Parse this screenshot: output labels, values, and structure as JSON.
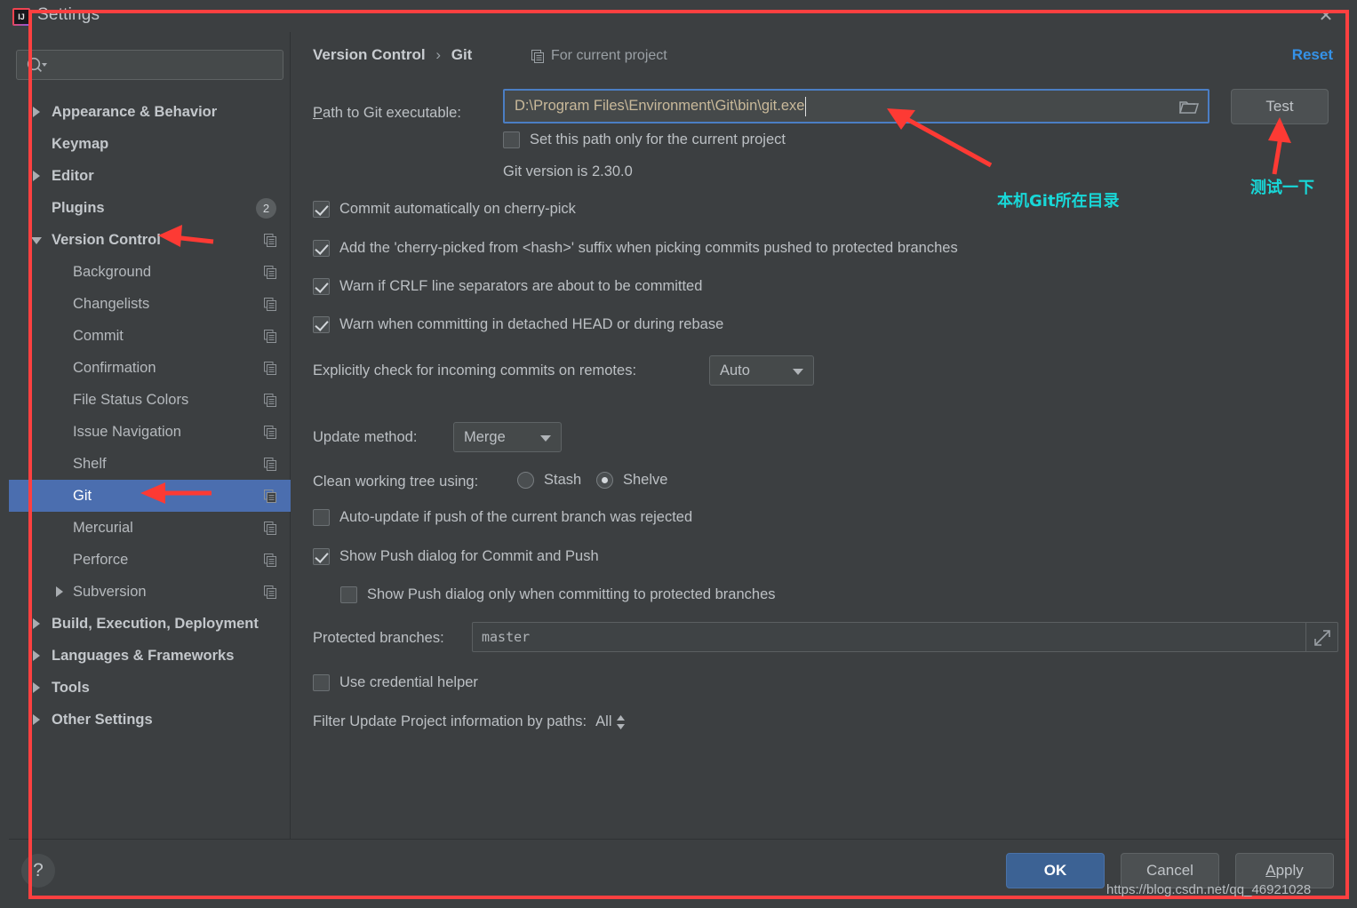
{
  "window": {
    "title": "Settings",
    "logo_icon": "intellij-idea-logo-icon",
    "close_icon": "close-icon"
  },
  "sidebar": {
    "search": {
      "placeholder": "",
      "value": "",
      "icon": "search-icon"
    },
    "items": [
      {
        "label": "Appearance & Behavior",
        "level": 0,
        "bold": true,
        "twisty": "collapsed",
        "copy_icon": false
      },
      {
        "label": "Keymap",
        "level": 0,
        "bold": true,
        "twisty": "none",
        "copy_icon": false
      },
      {
        "label": "Editor",
        "level": 0,
        "bold": true,
        "twisty": "collapsed",
        "copy_icon": false
      },
      {
        "label": "Plugins",
        "level": 0,
        "bold": true,
        "twisty": "none",
        "copy_icon": false,
        "badge": "2"
      },
      {
        "label": "Version Control",
        "level": 0,
        "bold": true,
        "twisty": "expanded",
        "copy_icon": true
      },
      {
        "label": "Background",
        "level": 1,
        "bold": false,
        "twisty": "none",
        "copy_icon": true
      },
      {
        "label": "Changelists",
        "level": 1,
        "bold": false,
        "twisty": "none",
        "copy_icon": true
      },
      {
        "label": "Commit",
        "level": 1,
        "bold": false,
        "twisty": "none",
        "copy_icon": true
      },
      {
        "label": "Confirmation",
        "level": 1,
        "bold": false,
        "twisty": "none",
        "copy_icon": true
      },
      {
        "label": "File Status Colors",
        "level": 1,
        "bold": false,
        "twisty": "none",
        "copy_icon": true
      },
      {
        "label": "Issue Navigation",
        "level": 1,
        "bold": false,
        "twisty": "none",
        "copy_icon": true
      },
      {
        "label": "Shelf",
        "level": 1,
        "bold": false,
        "twisty": "none",
        "copy_icon": true
      },
      {
        "label": "Git",
        "level": 1,
        "bold": false,
        "twisty": "none",
        "copy_icon": true,
        "selected": true
      },
      {
        "label": "Mercurial",
        "level": 1,
        "bold": false,
        "twisty": "none",
        "copy_icon": true
      },
      {
        "label": "Perforce",
        "level": 1,
        "bold": false,
        "twisty": "none",
        "copy_icon": true
      },
      {
        "label": "Subversion",
        "level": 1,
        "bold": false,
        "twisty": "collapsed",
        "copy_icon": true
      },
      {
        "label": "Build, Execution, Deployment",
        "level": 0,
        "bold": true,
        "twisty": "collapsed",
        "copy_icon": false
      },
      {
        "label": "Languages & Frameworks",
        "level": 0,
        "bold": true,
        "twisty": "collapsed",
        "copy_icon": false
      },
      {
        "label": "Tools",
        "level": 0,
        "bold": true,
        "twisty": "collapsed",
        "copy_icon": false
      },
      {
        "label": "Other Settings",
        "level": 0,
        "bold": true,
        "twisty": "collapsed",
        "copy_icon": false
      }
    ]
  },
  "main": {
    "breadcrumb_root": "Version Control",
    "breadcrumb_sep": "›",
    "breadcrumb_leaf": "Git",
    "scope_label": "For current project",
    "scope_icon": "copy-scope-icon",
    "reset_label": "Reset",
    "path_label_pre": "P",
    "path_label_rest": "ath to Git executable:",
    "path_value": "D:\\Program Files\\Environment\\Git\\bin\\git.exe",
    "folder_icon": "folder-browse-icon",
    "test_button": "Test",
    "set_path_only_label": "Set this path only for the current project",
    "set_path_only_checked": false,
    "git_version_text": "Git version is 2.30.0",
    "checkboxes": [
      {
        "label": "Commit automatically on cherry-pick",
        "checked": true
      },
      {
        "label": "Add the 'cherry-picked from <hash>' suffix when picking commits pushed to protected branches",
        "checked": true
      },
      {
        "label": "Warn if CRLF line separators are about to be committed",
        "checked": true
      },
      {
        "label": "Warn when committing in detached HEAD or during rebase",
        "checked": true
      }
    ],
    "incoming_label": "Explicitly check for incoming commits on remotes:",
    "incoming_value": "Auto",
    "update_method_label": "Update method:",
    "update_method_value": "Merge",
    "clean_tree_label": "Clean working tree using:",
    "clean_tree_option_a": "Stash",
    "clean_tree_option_b": "Shelve",
    "clean_tree_selected": "Shelve",
    "auto_update_label": "Auto-update if push of the current branch was rejected",
    "auto_update_checked": false,
    "show_push_label": "Show Push dialog for Commit and Push",
    "show_push_checked": true,
    "show_push_protected_label": "Show Push dialog only when committing to protected branches",
    "show_push_protected_checked": false,
    "protected_branches_label": "Protected branches:",
    "protected_branches_value": "master",
    "expand_icon": "expand-diagonal-icon",
    "credential_helper_label": "Use credential helper",
    "credential_helper_checked": false,
    "filter_label": "Filter Update Project information by paths:",
    "filter_value": "All"
  },
  "footer": {
    "help_icon": "help-question-icon",
    "ok": "OK",
    "cancel": "Cancel",
    "apply_pre": "A",
    "apply_rest": "pply"
  },
  "annotations": {
    "git_dir_note": "本机Git所在目录",
    "test_note": "测试一下",
    "arrow_color": "#fd3a34",
    "note_color": "#18d8d8",
    "frame_color": "#fd4040"
  },
  "watermark": "https://blog.csdn.net/qq_46921028"
}
